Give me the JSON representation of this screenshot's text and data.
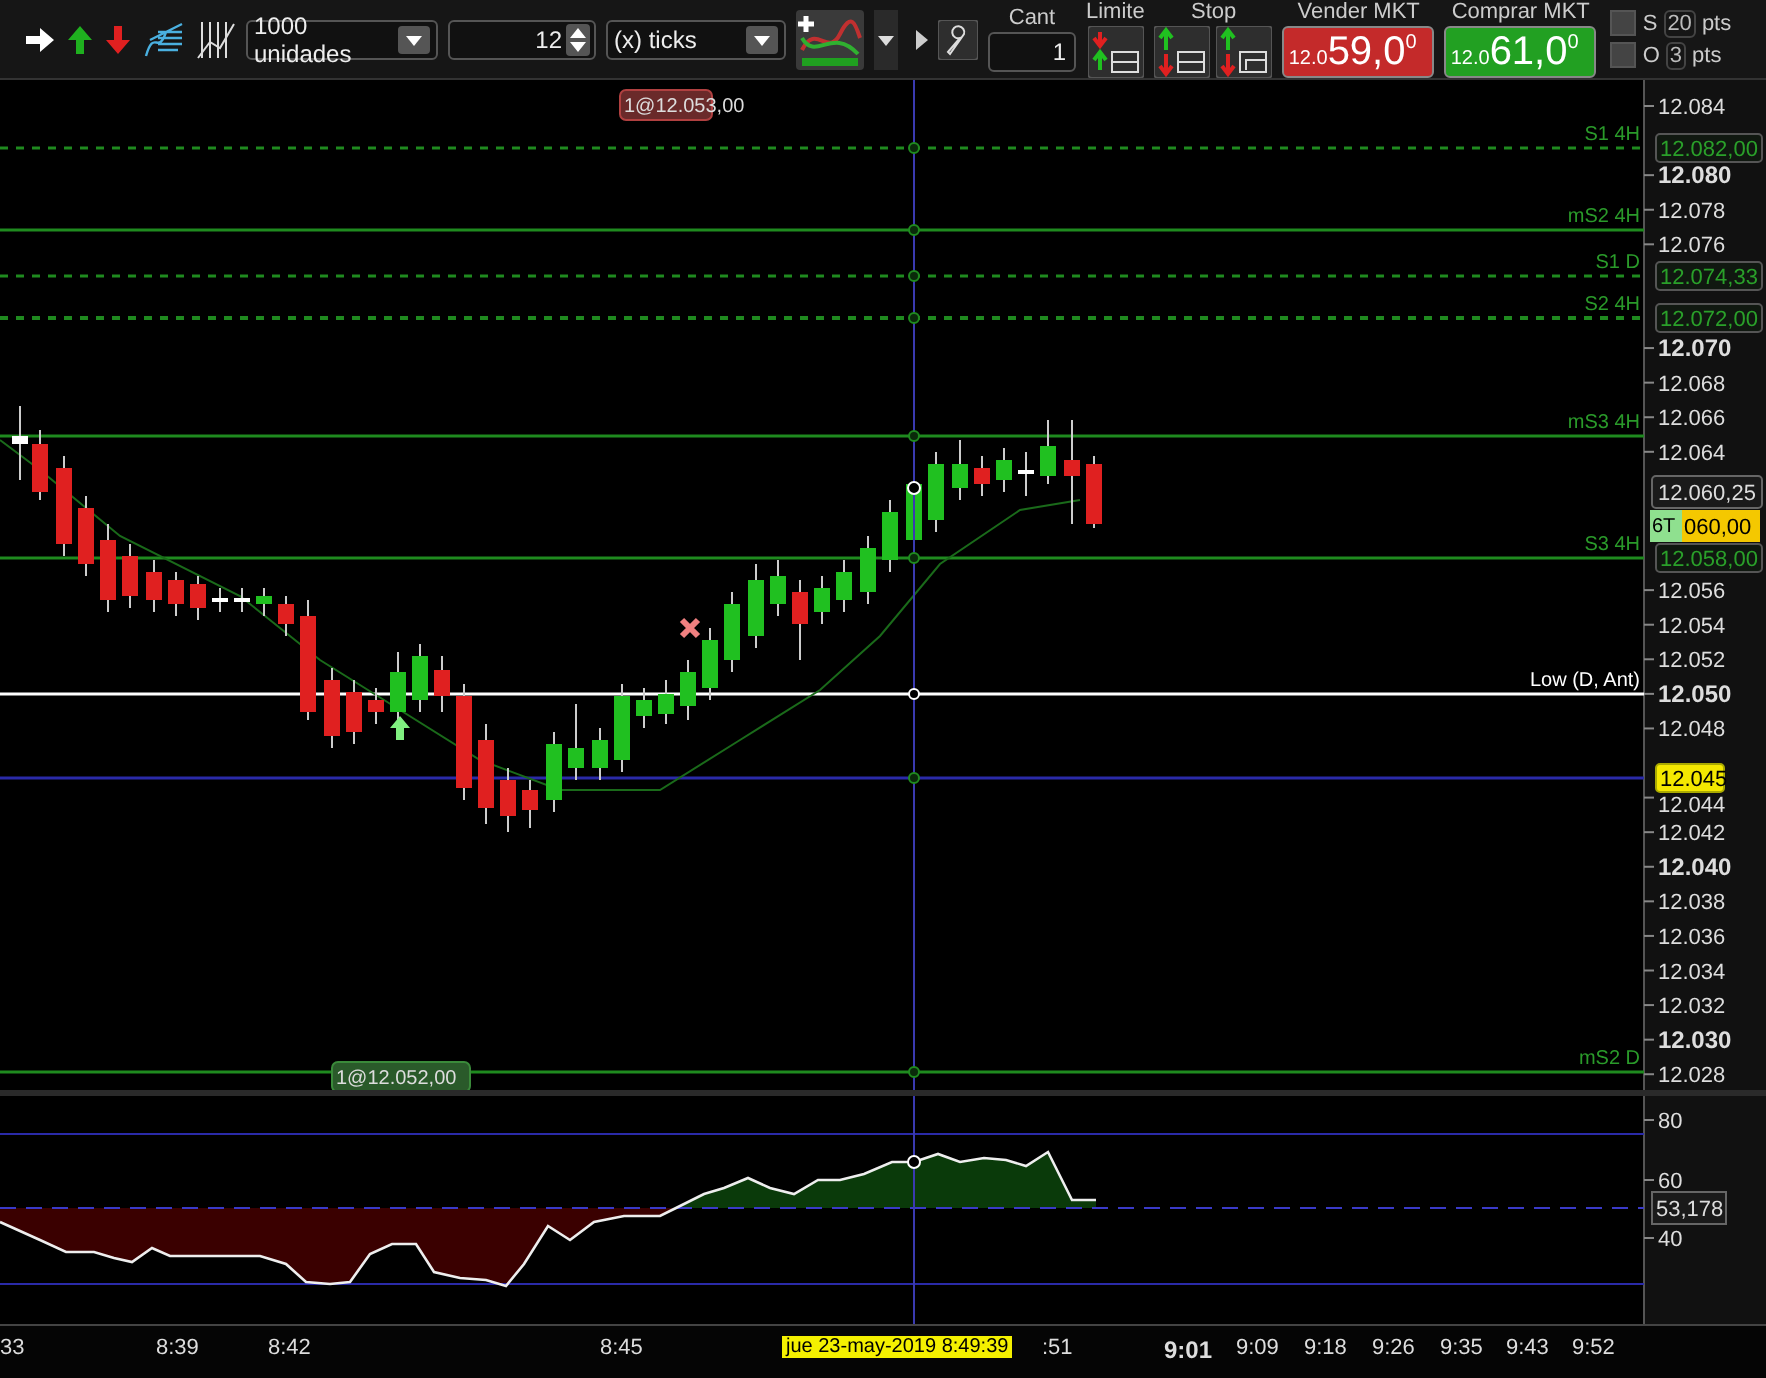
{
  "toolbar": {
    "quantity": {
      "value": "1000 unidades"
    },
    "ticks_spin": {
      "value": "12"
    },
    "ticks_unit": {
      "value": "(x) ticks"
    },
    "cant": {
      "label": "Cant",
      "value": "1"
    },
    "limit": {
      "label": "Limite"
    },
    "stop": {
      "label": "Stop"
    },
    "market_buttons": [
      {
        "label": "Vender MKT",
        "prefix": "12.0",
        "price": "59,0",
        "sup": "0",
        "kind": "sell"
      },
      {
        "label": "Comprar MKT",
        "prefix": "12.0",
        "price": "61,0",
        "sup": "0",
        "kind": "buy"
      }
    ],
    "offsets": [
      {
        "label": "S",
        "checked": false,
        "value": "20",
        "unit": "pts"
      },
      {
        "label": "O",
        "checked": false,
        "value": "3",
        "unit": "pts"
      }
    ]
  },
  "chart": {
    "orders": [
      {
        "text": "1@12.053,00",
        "kind": "sell"
      },
      {
        "text": "1@12.052,00",
        "kind": "buy"
      }
    ],
    "levels": [
      {
        "label": "S1 4H",
        "kind": "pivot",
        "tag": "12.082,00"
      },
      {
        "label": "mS2 4H",
        "kind": "line"
      },
      {
        "label": "S1 D",
        "kind": "pivot",
        "tag": "12.074,33"
      },
      {
        "label": "S2 4H",
        "kind": "pivot",
        "tag": "12.072,00"
      },
      {
        "label": "mS3 4H",
        "kind": "line"
      },
      {
        "label": "S3 4H",
        "kind": "line",
        "tag": "12.058,00"
      },
      {
        "label": "Low (D, Ant)",
        "kind": "low"
      },
      {
        "kind": "alert",
        "tag": "12.045"
      },
      {
        "label": "mS2 D",
        "kind": "line"
      }
    ],
    "price_tags": [
      {
        "text": "12.060,25",
        "kind": "last"
      },
      {
        "badge": "6T",
        "text": "060,00",
        "kind": "position"
      }
    ],
    "ticks": [
      {
        "label": "12.084",
        "bold": false
      },
      {
        "label": "12.080",
        "bold": true
      },
      {
        "label": "12.078",
        "bold": false
      },
      {
        "label": "12.076",
        "bold": false
      },
      {
        "label": "12.070",
        "bold": true
      },
      {
        "label": "12.068",
        "bold": false
      },
      {
        "label": "12.066",
        "bold": false
      },
      {
        "label": "12.064",
        "bold": false
      },
      {
        "label": "12.056",
        "bold": false
      },
      {
        "label": "12.054",
        "bold": false
      },
      {
        "label": "12.052",
        "bold": false
      },
      {
        "label": "12.050",
        "bold": true
      },
      {
        "label": "12.048",
        "bold": false
      },
      {
        "label": "12.044",
        "bold": false
      },
      {
        "label": "12.042",
        "bold": false
      },
      {
        "label": "12.040",
        "bold": true
      },
      {
        "label": "12.038",
        "bold": false
      },
      {
        "label": "12.036",
        "bold": false
      },
      {
        "label": "12.034",
        "bold": false
      },
      {
        "label": "12.032",
        "bold": false
      },
      {
        "label": "12.030",
        "bold": true
      },
      {
        "label": "12.028",
        "bold": false
      }
    ]
  },
  "oscillator": {
    "ticks": [
      "80",
      "60",
      "40"
    ],
    "tag": "53,178"
  },
  "time_axis": [
    {
      "text": "33",
      "bold": false,
      "kind": "tick"
    },
    {
      "text": "8:39",
      "bold": false,
      "kind": "tick"
    },
    {
      "text": "8:42",
      "bold": false,
      "kind": "tick"
    },
    {
      "text": "8:45",
      "bold": false,
      "kind": "tick"
    },
    {
      "text": "jue 23-may-2019 8:49:39",
      "bold": false,
      "kind": "cursor"
    },
    {
      "text": ":51",
      "bold": false,
      "kind": "tick"
    },
    {
      "text": "9:01",
      "bold": true,
      "kind": "tick"
    },
    {
      "text": "9:09",
      "bold": false,
      "kind": "tick"
    },
    {
      "text": "9:18",
      "bold": false,
      "kind": "tick"
    },
    {
      "text": "9:26",
      "bold": false,
      "kind": "tick"
    },
    {
      "text": "9:35",
      "bold": false,
      "kind": "tick"
    },
    {
      "text": "9:43",
      "bold": false,
      "kind": "tick"
    },
    {
      "text": "9:52",
      "bold": false,
      "kind": "tick"
    }
  ]
}
